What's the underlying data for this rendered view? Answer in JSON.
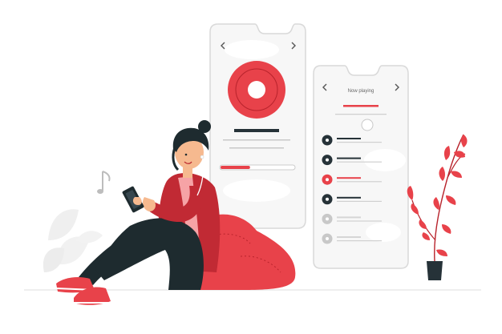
{
  "player_screen": {
    "title": "Now playing"
  },
  "colors": {
    "accent": "#e8424a",
    "accent_dark": "#b8232c",
    "phone_bg": "#f7f7f7",
    "phone_border": "#d9d9d9",
    "dark": "#263238",
    "muted": "#c8c8c8",
    "pants": "#1e2b2f",
    "skin": "#f6b98f"
  },
  "player": {
    "progress": 0.4
  },
  "playlist": {
    "items": [
      {
        "state": "dark"
      },
      {
        "state": "dark"
      },
      {
        "state": "active"
      },
      {
        "state": "dark"
      },
      {
        "state": "muted"
      },
      {
        "state": "muted"
      }
    ]
  },
  "icons": [
    "chevron-left-icon",
    "chevron-right-icon",
    "vinyl-disc-icon",
    "play-icon",
    "smartphone-icon",
    "music-note-icon"
  ]
}
